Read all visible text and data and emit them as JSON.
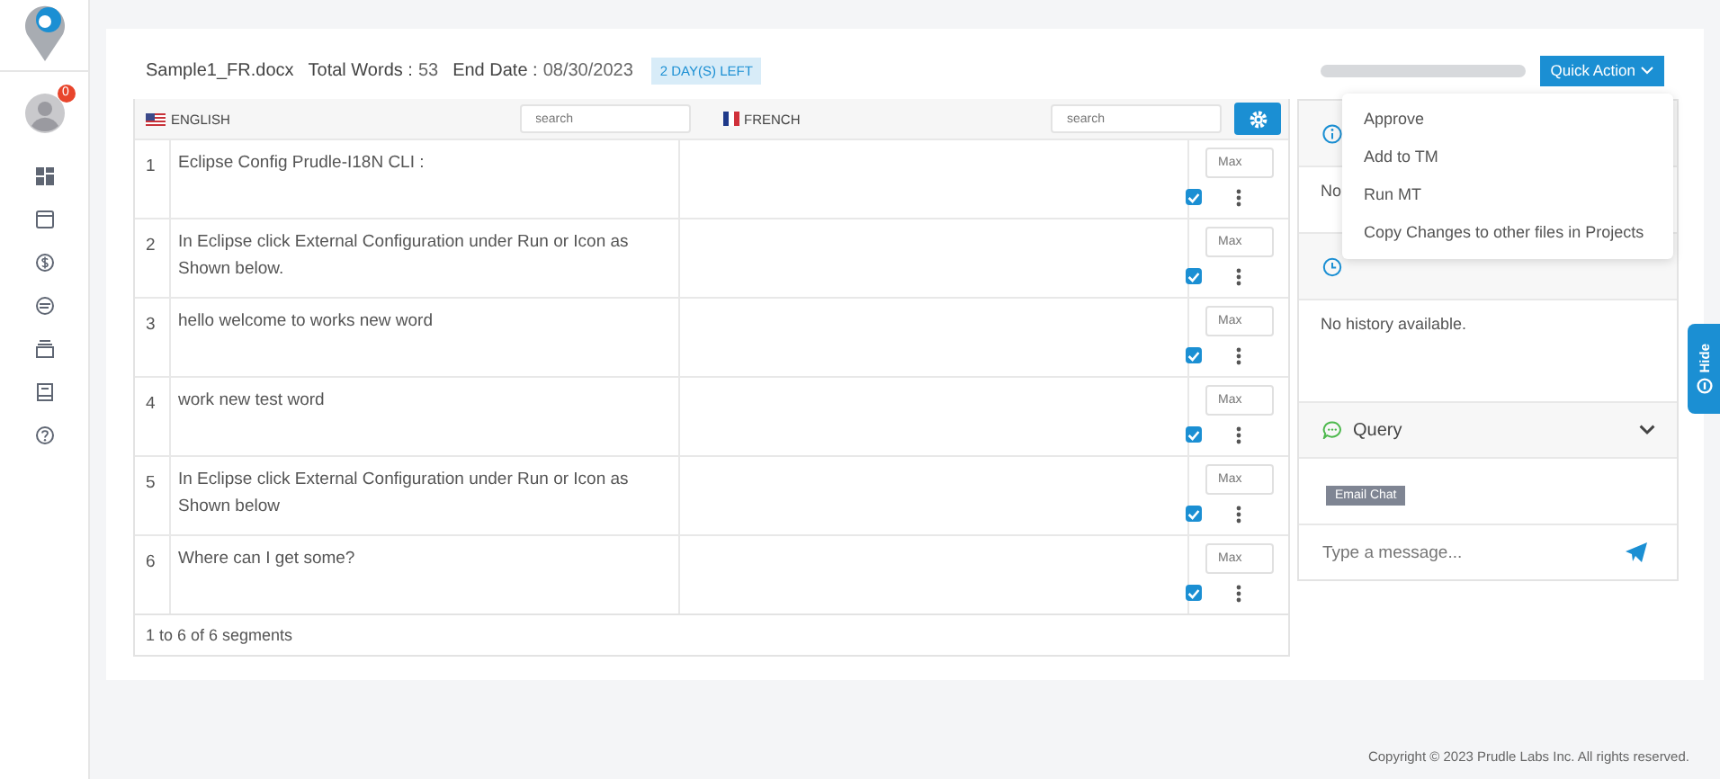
{
  "sidebar": {
    "notification_count": "0",
    "items": [
      {
        "kind": "dashboard"
      },
      {
        "kind": "window"
      },
      {
        "kind": "dollar"
      },
      {
        "kind": "chat"
      },
      {
        "kind": "stack"
      },
      {
        "kind": "book"
      },
      {
        "kind": "help"
      }
    ]
  },
  "header": {
    "file_name": "Sample1_FR.docx",
    "total_words": {
      "label": "Total Words :",
      "value": "53"
    },
    "end_date": {
      "label": "End Date :",
      "value": "08/30/2023"
    },
    "badge": "2 DAY(S) LEFT",
    "progress": {
      "level": 0
    },
    "quick_action": "Quick Action"
  },
  "quick_action_menu": [
    "Approve",
    "Add to TM",
    "Run MT",
    "Copy Changes to other files in Projects"
  ],
  "table": {
    "source": {
      "language": "ENGLISH",
      "search_placeholder": "search"
    },
    "target": {
      "language": "FRENCH",
      "search_placeholder": "search"
    },
    "rows": [
      {
        "number": "1",
        "source": "Eclipse Config Prudle-I18N CLI :",
        "max_placeholder": "Max",
        "checked": true
      },
      {
        "number": "2",
        "source": "In Eclipse click External Configuration under Run or Icon as Shown below.",
        "max_placeholder": "Max",
        "checked": true
      },
      {
        "number": "3",
        "source": "hello welcome to works new word",
        "max_placeholder": "Max",
        "checked": true
      },
      {
        "number": "4",
        "source": "work new test word",
        "max_placeholder": "Max",
        "checked": true
      },
      {
        "number": "5",
        "source": "In Eclipse click External Configuration under Run or Icon as Shown below",
        "max_placeholder": "Max",
        "checked": true
      },
      {
        "number": "6",
        "source": "Where can I get some?",
        "max_placeholder": "Max",
        "checked": true
      }
    ],
    "footer": "1 to 6 of 6 segments"
  },
  "side_panel": {
    "info_text": "No",
    "history_text": "No history available.",
    "query_title": "Query",
    "email_chat": "Email Chat",
    "message_placeholder": "Type a message..."
  },
  "hide_tab": "Hide",
  "copyright": "Copyright © 2023 Prudle Labs Inc. All rights reserved."
}
